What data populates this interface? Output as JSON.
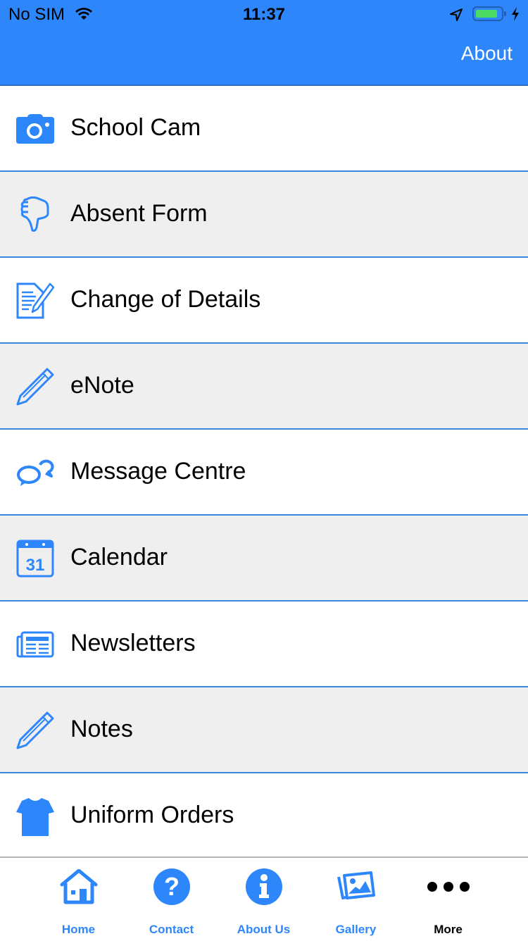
{
  "status_bar": {
    "carrier": "No SIM",
    "time": "11:37",
    "battery_level": 0.85,
    "charging": true
  },
  "header": {
    "about_label": "About"
  },
  "colors": {
    "brand": "#2d87fb",
    "separator": "#3a87e0",
    "alt_row": "#efefef",
    "battery": "#4cd964"
  },
  "menu": {
    "items": [
      {
        "label": "School Cam",
        "icon": "camera-icon"
      },
      {
        "label": "Absent Form",
        "icon": "thumbs-down-icon"
      },
      {
        "label": "Change of Details",
        "icon": "edit-document-icon"
      },
      {
        "label": "eNote",
        "icon": "pencil-icon"
      },
      {
        "label": "Message Centre",
        "icon": "chat-bubbles-icon"
      },
      {
        "label": "Calendar",
        "icon": "calendar-icon",
        "icon_text": "31"
      },
      {
        "label": "Newsletters",
        "icon": "newspaper-icon"
      },
      {
        "label": "Notes",
        "icon": "pencil-icon"
      },
      {
        "label": "Uniform Orders",
        "icon": "tshirt-icon"
      }
    ]
  },
  "tabbar": {
    "tabs": [
      {
        "label": "Home",
        "icon": "home-icon"
      },
      {
        "label": "Contact",
        "icon": "question-circle-icon"
      },
      {
        "label": "About Us",
        "icon": "info-circle-icon"
      },
      {
        "label": "Gallery",
        "icon": "gallery-icon"
      },
      {
        "label": "More",
        "icon": "more-dots-icon",
        "active": true
      }
    ]
  }
}
